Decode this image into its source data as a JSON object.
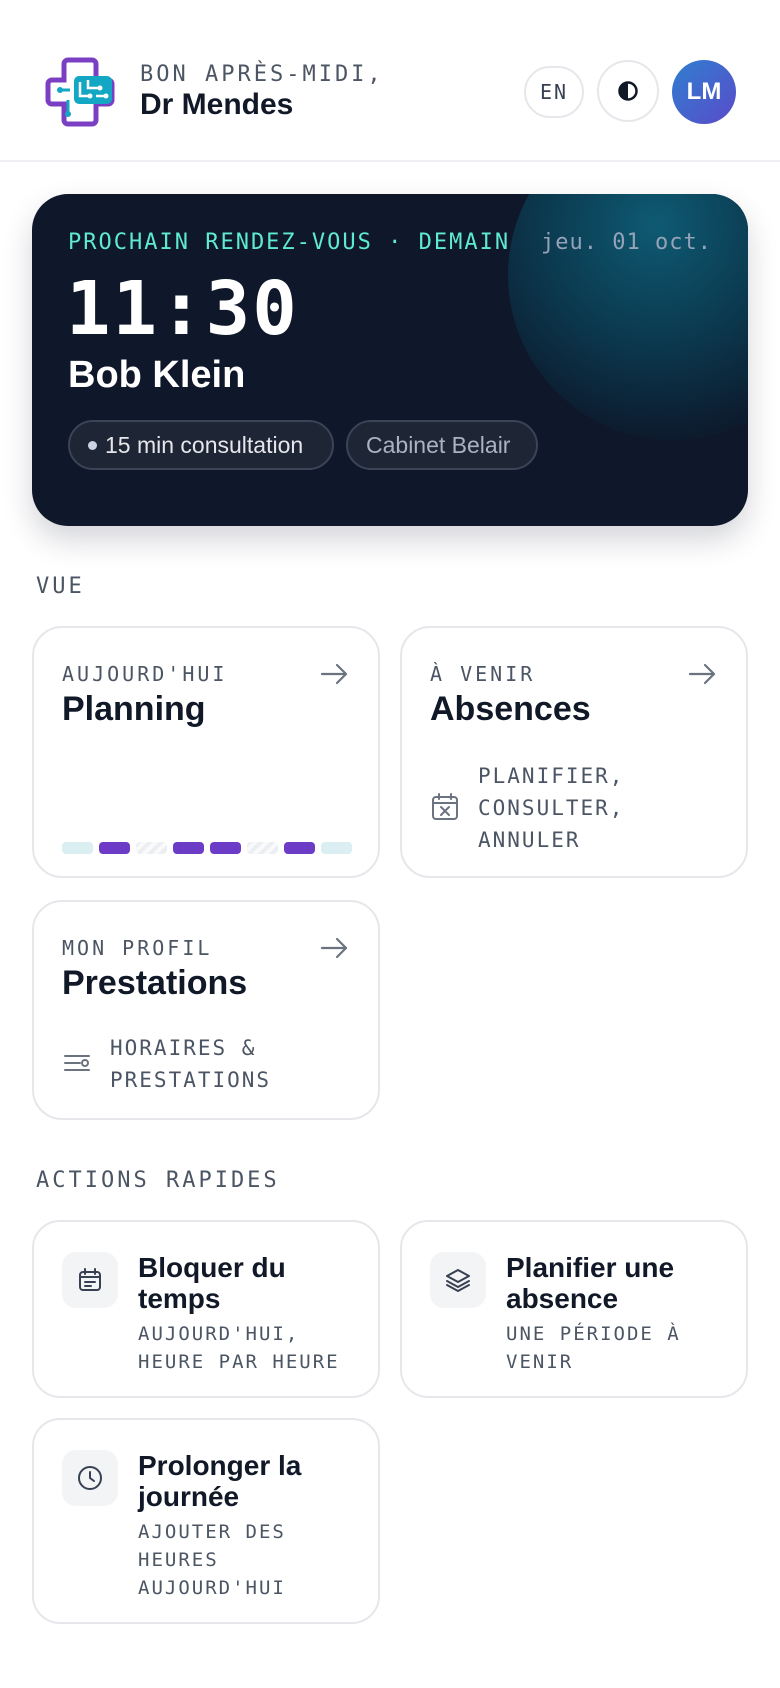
{
  "header": {
    "greeting": "BON APRÈS-MIDI,",
    "doctor_name": "Dr Mendes",
    "language_button": "EN",
    "theme_toggle_icon": "contrast-icon",
    "avatar_initials": "LM"
  },
  "next_appointment": {
    "label": "PROCHAIN RENDEZ-VOUS · DEMAIN",
    "date": "jeu. 01 oct.",
    "time": "11:30",
    "patient": "Bob Klein",
    "duration_chip": "15 min consultation",
    "location_chip": "Cabinet Belair"
  },
  "overview": {
    "section_label": "VUE",
    "cards": [
      {
        "eyebrow": "AUJOURD'HUI",
        "title": "Planning",
        "schedule_slots": [
          "free",
          "busy",
          "blocked",
          "busy",
          "busy",
          "blocked",
          "busy",
          "free"
        ]
      },
      {
        "eyebrow": "À VENIR",
        "title": "Absences",
        "icon": "calendar-x-icon",
        "subtitle_lines": [
          "PLANIFIER,",
          "CONSULTER,",
          "ANNULER"
        ]
      },
      {
        "eyebrow": "MON PROFIL",
        "title": "Prestations",
        "icon": "sliders-icon",
        "subtitle_lines": [
          "HORAIRES &",
          "PRESTATIONS"
        ]
      }
    ]
  },
  "quick_actions": {
    "section_label": "ACTIONS RAPIDES",
    "items": [
      {
        "icon": "calendar-icon",
        "title": "Bloquer du temps",
        "subtitle": "AUJOURD'HUI, HEURE PAR HEURE"
      },
      {
        "icon": "layers-icon",
        "title": "Planifier une absence",
        "subtitle": "UNE PÉRIODE À VENIR"
      },
      {
        "icon": "clock-icon",
        "title": "Prolonger la journée",
        "subtitle": "AJOUTER DES HEURES AUJOURD'HUI"
      }
    ]
  },
  "colors": {
    "accent_purple": "#6d3cc6",
    "accent_teal": "#5eead4",
    "hero_background": "#0f172a",
    "logo_teal": "#14a7c4",
    "logo_purple": "#7b3fc4"
  }
}
